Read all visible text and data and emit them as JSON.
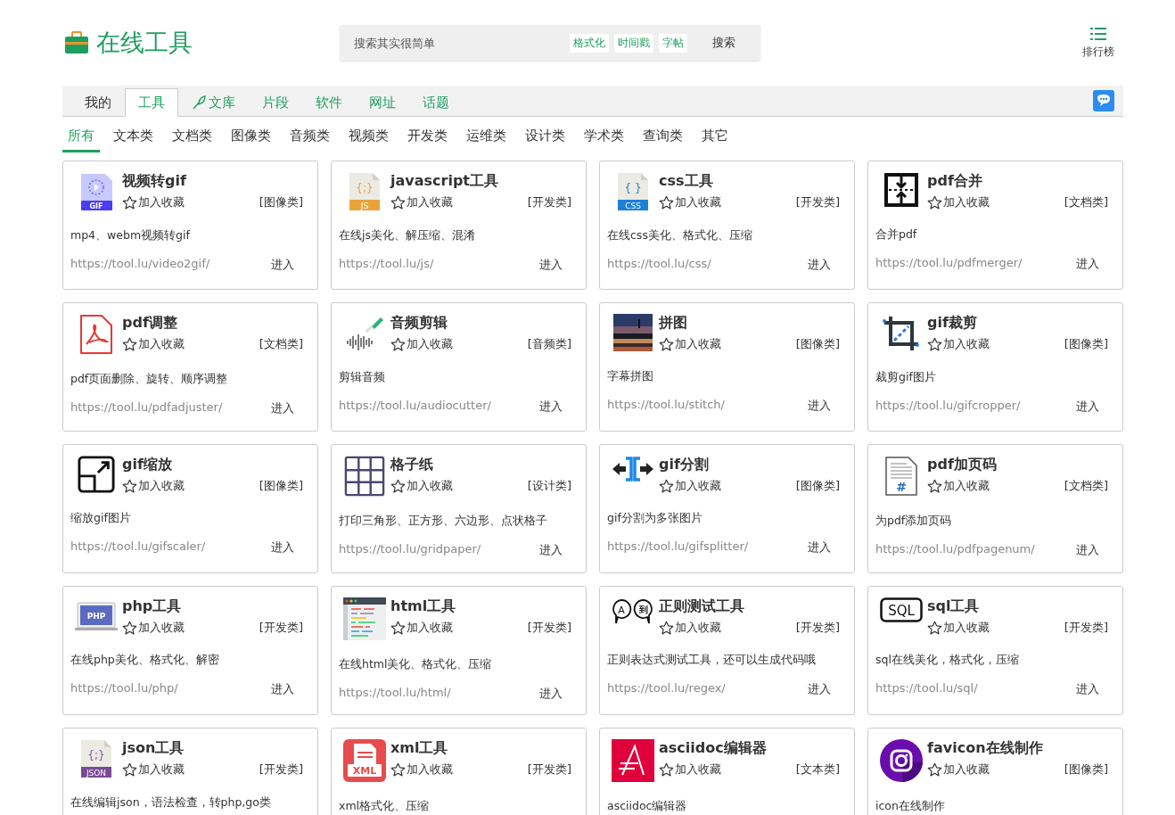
{
  "header": {
    "logo_text": "在线工具",
    "search": {
      "placeholder": "搜索其实很简单",
      "tags": [
        "格式化",
        "时间戳",
        "字帖"
      ],
      "button": "搜索"
    },
    "ranking": {
      "label": "排行榜"
    }
  },
  "nav": {
    "tabs": [
      {
        "label": "我的",
        "selected": false,
        "kind": "plain"
      },
      {
        "label": "工具",
        "selected": true,
        "kind": "plain"
      },
      {
        "label": "文库",
        "selected": false,
        "kind": "feather"
      },
      {
        "label": "片段",
        "selected": false,
        "kind": "plain"
      },
      {
        "label": "软件",
        "selected": false,
        "kind": "plain"
      },
      {
        "label": "网址",
        "selected": false,
        "kind": "plain"
      },
      {
        "label": "话题",
        "selected": false,
        "kind": "plain"
      }
    ]
  },
  "categories": [
    {
      "label": "所有",
      "selected": true
    },
    {
      "label": "文本类",
      "selected": false
    },
    {
      "label": "文档类",
      "selected": false
    },
    {
      "label": "图像类",
      "selected": false
    },
    {
      "label": "音频类",
      "selected": false
    },
    {
      "label": "视频类",
      "selected": false
    },
    {
      "label": "开发类",
      "selected": false
    },
    {
      "label": "运维类",
      "selected": false
    },
    {
      "label": "设计类",
      "selected": false
    },
    {
      "label": "学术类",
      "selected": false
    },
    {
      "label": "查询类",
      "selected": false
    },
    {
      "label": "其它",
      "selected": false
    }
  ],
  "cards": [
    {
      "kind": "gif",
      "icon_labels": [
        "GIF"
      ],
      "title": "视频转gif",
      "favorite": "加入收藏",
      "favorited": false,
      "category": "[图像类]",
      "description": "mp4、webm视频转gif",
      "url": "https://tool.lu/video2gif/",
      "enter": "进入"
    },
    {
      "kind": "js",
      "icon_labels": [
        "{;}",
        "JS"
      ],
      "title": "javascript工具",
      "favorite": "加入收藏",
      "favorited": false,
      "category": "[开发类]",
      "description": "在线js美化、解压缩、混淆",
      "url": "https://tool.lu/js/",
      "enter": "进入"
    },
    {
      "kind": "css",
      "icon_labels": [
        "{ }",
        "CSS"
      ],
      "title": "css工具",
      "favorite": "加入收藏",
      "favorited": false,
      "category": "[开发类]",
      "description": "在线css美化、格式化、压缩",
      "url": "https://tool.lu/css/",
      "enter": "进入"
    },
    {
      "kind": "merge",
      "title": "pdf合并",
      "favorite": "加入收藏",
      "favorited": false,
      "category": "[文档类]",
      "description": "合并pdf",
      "url": "https://tool.lu/pdfmerger/",
      "enter": "进入"
    },
    {
      "kind": "pdf",
      "title": "pdf调整",
      "favorite": "加入收藏",
      "favorited": false,
      "category": "[文档类]",
      "description": "pdf页面删除、旋转、顺序调整",
      "url": "https://tool.lu/pdfadjuster/",
      "enter": "进入"
    },
    {
      "kind": "audio",
      "title": "音频剪辑",
      "favorite": "加入收藏",
      "favorited": false,
      "category": "[音频类]",
      "description": "剪辑音频",
      "url": "https://tool.lu/audiocutter/",
      "enter": "进入"
    },
    {
      "title": "拼图",
      "favorite": "加入收藏",
      "favorited": false,
      "category": "[图像类]",
      "description": "字幕拼图",
      "url": "https://tool.lu/stitch/",
      "enter": "进入"
    },
    {
      "kind": "crop",
      "title": "gif裁剪",
      "favorite": "加入收藏",
      "favorited": false,
      "category": "[图像类]",
      "description": "裁剪gif图片",
      "url": "https://tool.lu/gifcropper/",
      "enter": "进入"
    },
    {
      "kind": "scale",
      "title": "gif缩放",
      "favorite": "加入收藏",
      "favorited": false,
      "category": "[图像类]",
      "description": "缩放gif图片",
      "url": "https://tool.lu/gifscaler/",
      "enter": "进入"
    },
    {
      "kind": "grid",
      "title": "格子纸",
      "favorite": "加入收藏",
      "favorited": false,
      "category": "[设计类]",
      "description": "打印三角形、正方形、六边形、点状格子",
      "url": "https://tool.lu/gridpaper/",
      "enter": "进入"
    },
    {
      "kind": "split",
      "title": "gif分割",
      "favorite": "加入收藏",
      "favorited": false,
      "category": "[图像类]",
      "description": "gif分割为多张图片",
      "url": "https://tool.lu/gifsplitter/",
      "enter": "进入"
    },
    {
      "kind": "pagenum",
      "icon_labels": [
        "#"
      ],
      "title": "pdf加页码",
      "favorite": "加入收藏",
      "favorited": false,
      "category": "[文档类]",
      "description": "为pdf添加页码",
      "url": "https://tool.lu/pdfpagenum/",
      "enter": "进入"
    },
    {
      "kind": "php",
      "icon_labels": [
        "PHP"
      ],
      "title": "php工具",
      "favorite": "加入收藏",
      "favorited": false,
      "category": "[开发类]",
      "description": "在线php美化、格式化、解密",
      "url": "https://tool.lu/php/",
      "enter": "进入"
    },
    {
      "kind": "html",
      "title": "html工具",
      "favorite": "加入收藏",
      "favorited": false,
      "category": "[开发类]",
      "description": "在线html美化、格式化、压缩",
      "url": "https://tool.lu/html/",
      "enter": "进入"
    },
    {
      "kind": "regex",
      "icon_labels": [
        "A",
        "到"
      ],
      "title": "正则测试工具",
      "favorite": "加入收藏",
      "favorited": false,
      "category": "[开发类]",
      "description": "正则表达式测试工具，还可以生成代码哦",
      "url": "https://tool.lu/regex/",
      "enter": "进入"
    },
    {
      "kind": "sql",
      "icon_labels": [
        "SQL"
      ],
      "title": "sql工具",
      "favorite": "加入收藏",
      "favorited": false,
      "category": "[开发类]",
      "description": "sql在线美化，格式化，压缩",
      "url": "https://tool.lu/sql/",
      "enter": "进入"
    },
    {
      "kind": "json",
      "icon_labels": [
        "{;}",
        "JSON"
      ],
      "title": "json工具",
      "favorite": "加入收藏",
      "favorited": false,
      "category": "[开发类]",
      "description": "在线编辑json，语法检查，转php,go类"
    },
    {
      "kind": "xml",
      "icon_labels": [
        "XML"
      ],
      "title": "xml工具",
      "favorite": "加入收藏",
      "favorited": false,
      "category": "[开发类]",
      "description": "xml格式化、压缩"
    },
    {
      "kind": "asciidoc",
      "title": "asciidoc编辑器",
      "favorite": "加入收藏",
      "favorited": false,
      "category": "[文本类]",
      "description": "asciidoc编辑器"
    },
    {
      "kind": "camera",
      "title": "favicon在线制作",
      "favorite": "加入收藏",
      "favorited": false,
      "category": "[图像类]",
      "description": "icon在线制作"
    }
  ]
}
